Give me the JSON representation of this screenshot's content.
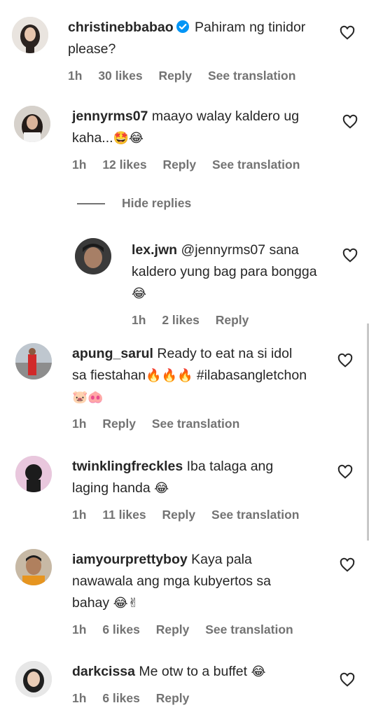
{
  "comments": [
    {
      "username": "christinebbabao",
      "verified": true,
      "text": "Pahiram ng tinidor please?",
      "emoji": "",
      "time": "1h",
      "likes": "30 likes",
      "reply_label": "Reply",
      "translation_label": "See translation"
    },
    {
      "username": "jennyrms07",
      "text": "maayo walay kaldero ug kaha...",
      "emoji": "🤩😂",
      "time": "1h",
      "likes": "12 likes",
      "reply_label": "Reply",
      "translation_label": "See translation"
    },
    {
      "username": "apung_sarul",
      "text": "Ready to eat na si idol sa fiestahan",
      "emoji": "🔥🔥🔥",
      "text2": "#ilabasangletchon",
      "emoji2": "🐷🐽",
      "time": "1h",
      "reply_label": "Reply",
      "translation_label": "See translation"
    },
    {
      "username": "twinklingfreckles",
      "text": "Iba talaga ang laging handa",
      "emoji": "😂",
      "time": "1h",
      "likes": "11 likes",
      "reply_label": "Reply",
      "translation_label": "See translation"
    },
    {
      "username": "iamyourprettyboy",
      "text": "Kaya pala nawawala ang mga kubyertos sa bahay",
      "emoji": "😂✌",
      "time": "1h",
      "likes": "6 likes",
      "reply_label": "Reply",
      "translation_label": "See translation"
    },
    {
      "username": "darkcissa",
      "text": "Me otw to a buffet",
      "emoji": "😂",
      "time": "1h",
      "likes": "6 likes",
      "reply_label": "Reply"
    }
  ],
  "hide_replies_label": "Hide replies",
  "reply": {
    "username": "lex.jwn",
    "mention": "@jennyrms07",
    "text": "sana kaldero yung bag para bongga",
    "emoji": "😂",
    "time": "1h",
    "likes": "2 likes",
    "reply_label": "Reply"
  },
  "colors": {
    "text": "#262626",
    "meta": "#737373",
    "verified": "#0095f6"
  }
}
